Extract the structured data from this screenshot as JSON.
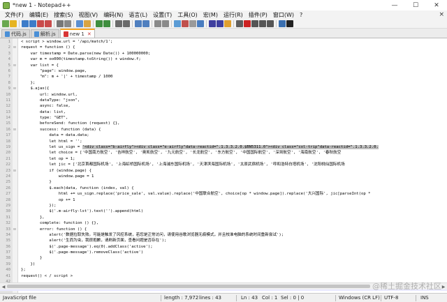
{
  "window": {
    "title": "*new 1 - Notepad++",
    "minimize": "—",
    "maximize": "☐",
    "close": "✕"
  },
  "menu": {
    "items": [
      "文件(F)",
      "编辑(E)",
      "搜索(S)",
      "视图(V)",
      "编码(N)",
      "语言(L)",
      "设置(T)",
      "工具(O)",
      "宏(M)",
      "运行(R)",
      "插件(P)",
      "窗口(W)",
      "?"
    ],
    "close_glyph": "×"
  },
  "toolbar": {
    "buttons": [
      "new-icon",
      "open-icon",
      "save-icon",
      "save-all-icon",
      "close-icon",
      "close-all-icon",
      "print-icon",
      "cut-icon",
      "copy-icon",
      "paste-icon",
      "undo-icon",
      "redo-icon",
      "find-icon",
      "replace-icon",
      "zoom-in-icon",
      "zoom-out-icon",
      "sync-v-icon",
      "sync-h-icon",
      "wrap-icon",
      "all-chars-icon",
      "indent-guide-icon",
      "lang-icon",
      "doc-map-icon",
      "func-list-icon",
      "folder-workspace-icon",
      "monitor-icon",
      "record-icon",
      "stop-icon",
      "play-icon",
      "play-multi-icon",
      "save-macro-icon",
      "spell-icon"
    ]
  },
  "tabs": [
    {
      "label": "代码.js",
      "active": false
    },
    {
      "label": "解析.js",
      "active": false
    },
    {
      "label": "new 1",
      "active": true
    }
  ],
  "editor": {
    "current_line": 43,
    "lines": [
      {
        "n": "1",
        "fold": "",
        "text": "< script > window.url = '/api/match/1';"
      },
      {
        "n": "2",
        "fold": "⊟",
        "text": "request = function () {"
      },
      {
        "n": "3",
        "fold": "",
        "text": "    var timestamp = Date.parse(new Date()) + 100000000;"
      },
      {
        "n": "4",
        "fold": "",
        "text": "    var m = oo000(timestamp.toString()) + window.f;"
      },
      {
        "n": "5",
        "fold": "⊟",
        "text": "    var list = {"
      },
      {
        "n": "6",
        "fold": "",
        "text": "        \"page\": window.page,"
      },
      {
        "n": "7",
        "fold": "",
        "text": "        \"m\": m + '|' + timestamp / 1000"
      },
      {
        "n": "8",
        "fold": "",
        "text": "    };"
      },
      {
        "n": "9",
        "fold": "⊟",
        "text": "    $.ajax({"
      },
      {
        "n": "10",
        "fold": "",
        "text": "        url: window.url,"
      },
      {
        "n": "11",
        "fold": "",
        "text": "        dataType: \"json\","
      },
      {
        "n": "12",
        "fold": "",
        "text": "        async: false,"
      },
      {
        "n": "13",
        "fold": "",
        "text": "        data: list,"
      },
      {
        "n": "14",
        "fold": "",
        "text": "        type: \"GET\","
      },
      {
        "n": "15",
        "fold": "",
        "text": "        beforeSend: function (request) {},"
      },
      {
        "n": "16",
        "fold": "⊟",
        "text": "        success: function (data) {"
      },
      {
        "n": "17",
        "fold": "",
        "text": "            data = data.data;"
      },
      {
        "n": "18",
        "fold": "",
        "text": "            let html = '';"
      },
      {
        "n": "19",
        "fold": "",
        "text": "            let us_sign = '<div class=\"b-airfly\"><div class=\"e-airfly\"data-reactid=\".1.3.3.2.0.$BN5311.0\"><div class=\"col-trip\"data-reactid=\".1.3.3.2.0."
      },
      {
        "n": "20",
        "fold": "",
        "text": "            let choice = ['中国南方航空', '吉祥航空', '奥凯航空', '九元航空', '长龙航空', '东方航空', '中国国际航空', '深圳航空', '海南航空', '春秋航空"
      },
      {
        "n": "21",
        "fold": "",
        "text": "            let op = 1;"
      },
      {
        "n": "22",
        "fold": "",
        "text": "            let jic = ['北京首都国际机场', '上海虹桥国际机场', '上海浦东国际机场', '天津滨海国际机场', '太原武宿机场', '呼和浩特白塔机场', '沈阳桃仙国际机场"
      },
      {
        "n": "23",
        "fold": "⊟",
        "text": "            if (window.page) {"
      },
      {
        "n": "24",
        "fold": "",
        "text": "                window.page = 1"
      },
      {
        "n": "25",
        "fold": "",
        "text": "            }"
      },
      {
        "n": "26",
        "fold": "",
        "text": "            $.each(data, function (index, val) {"
      },
      {
        "n": "27",
        "fold": "",
        "text": "                html += us_sign.replace('price_sale', val.value).replace('中国联合航空', choice[op * window.page]).replace('大兴国际', jic[parseInt(op *"
      },
      {
        "n": "28",
        "fold": "",
        "text": "                op += 1"
      },
      {
        "n": "29",
        "fold": "",
        "text": "            });"
      },
      {
        "n": "30",
        "fold": "",
        "text": "            $('.m-airfly-lst').text('').append(html)"
      },
      {
        "n": "31",
        "fold": "",
        "text": "        },"
      },
      {
        "n": "32",
        "fold": "",
        "text": "        complete: function () {},"
      },
      {
        "n": "33",
        "fold": "⊟",
        "text": "        error: function () {"
      },
      {
        "n": "34",
        "fold": "",
        "text": "            alert('数据拉取失败。可能是触发了风控系统，若您是正常访问，请使用谷歌浏览器无痕模式，并且校准电脑的系统时间重新尝试');"
      },
      {
        "n": "35",
        "fold": "",
        "text": "            alert('生而为虫，我很抱歉，请刷新页面，查看问题是否存在');"
      },
      {
        "n": "36",
        "fold": "",
        "text": "            $('.page-message').eq(0).addClass('active');"
      },
      {
        "n": "37",
        "fold": "",
        "text": "            $('.page-message').removeClass('active')"
      },
      {
        "n": "38",
        "fold": "",
        "text": "        }"
      },
      {
        "n": "39",
        "fold": "",
        "text": "    })"
      },
      {
        "n": "40",
        "fold": "",
        "text": "};"
      },
      {
        "n": "41",
        "fold": "",
        "text": "request() < / script >"
      },
      {
        "n": "42",
        "fold": "",
        "text": ""
      },
      {
        "n": "43",
        "fold": "",
        "text": ""
      }
    ]
  },
  "watermark": "@稀土掘金技术社区",
  "status": {
    "language": "JavaScript file",
    "length": "length : 7,972",
    "lines": "lines : 43",
    "ln": "Ln : 43",
    "col": "Col : 1",
    "sel": "Sel : 0 | 0",
    "eol": "Windows (CR LF)",
    "encoding": "UTF-8",
    "mode": "INS"
  },
  "colors": {
    "menubar": "#f3f3f3",
    "gutter": "#e4e4e4",
    "active_tab_accent": "#f5a623",
    "selection": "#c0c0c0",
    "current_line": "#e8e8ff"
  }
}
